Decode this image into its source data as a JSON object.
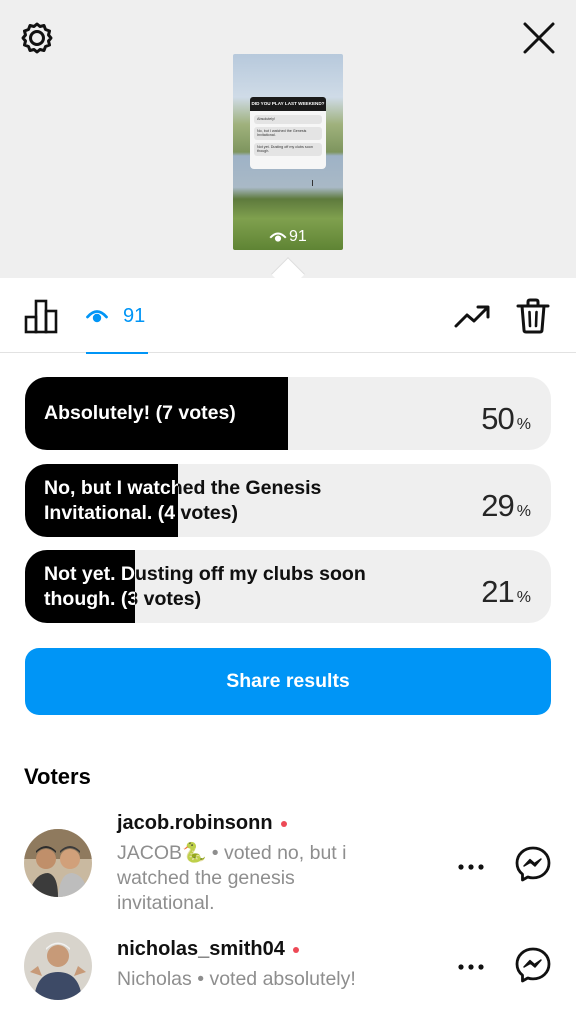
{
  "icons": {
    "settings": "gear-icon",
    "close": "close-icon",
    "results_tab": "bar-chart-icon",
    "views_tab": "eye-icon",
    "insights": "trending-up-icon",
    "delete": "trash-icon",
    "more": "more-horizontal-icon",
    "message": "messenger-icon"
  },
  "story_preview": {
    "question": "DID YOU PLAY LAST WEEKEND?",
    "options": [
      "Absolutely!",
      "No, but I watched the Genesis Invitational.",
      "Not yet. Dusting off my clubs soon though."
    ],
    "views": "91"
  },
  "tabs": {
    "views_count": "91"
  },
  "poll": {
    "options": [
      {
        "label": "Absolutely! (7 votes)",
        "percent": 50,
        "percent_label": "50",
        "percent_sign": "%"
      },
      {
        "label_line1": "No, but I watched the Genesis",
        "label_line2": "Invitational. (4 votes)",
        "percent": 29,
        "percent_label": "29",
        "percent_sign": "%"
      },
      {
        "label_line1": "Not yet. Dusting off my clubs soon",
        "label_line2": "though. (3 votes)",
        "percent": 21,
        "percent_label": "21",
        "percent_sign": "%"
      }
    ]
  },
  "share_button": "Share results",
  "voters": {
    "title": "Voters",
    "list": [
      {
        "username": "jacob.robinsonn",
        "subtitle_line1": "JACOB🐍 • voted no, but i",
        "subtitle_line2": "watched the genesis",
        "subtitle_line3": "invitational."
      },
      {
        "username": "nicholas_smith04",
        "subtitle_line1": "Nicholas • voted absolutely!"
      }
    ]
  },
  "colors": {
    "accent": "#0095f6",
    "bar_fill": "#000000",
    "bar_track": "#efefef",
    "online_dot": "#ed4956"
  }
}
